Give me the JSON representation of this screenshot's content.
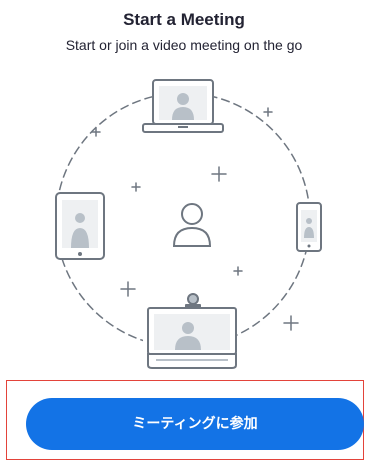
{
  "header": {
    "title": "Start a Meeting",
    "subtitle": "Start or join a video meeting on the go"
  },
  "illustration": {
    "icons": [
      "laptop-icon",
      "tablet-icon",
      "user-icon",
      "phone-icon",
      "video-room-icon"
    ],
    "line_color": "#6e7680",
    "accent_fill": "#b8c0c8"
  },
  "actions": {
    "join_meeting_label": "ミーティングに参加"
  },
  "colors": {
    "primary": "#1373e6",
    "highlight": "#e3433a",
    "text": "#232333"
  }
}
